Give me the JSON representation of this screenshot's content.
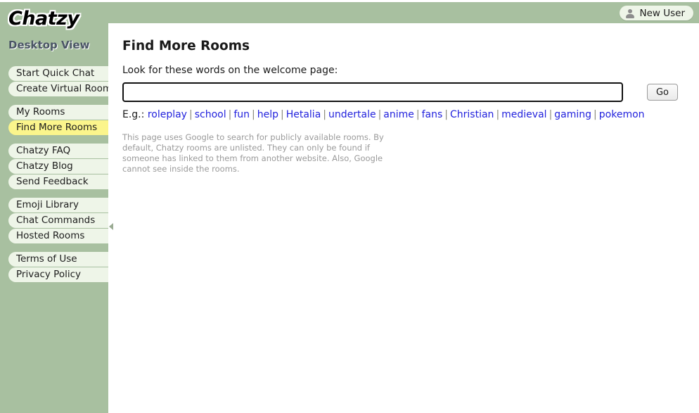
{
  "brand": {
    "logo_text": "Chatzy",
    "view_label": "Desktop View"
  },
  "header": {
    "new_user_label": "New User",
    "new_user_icon": "user-icon"
  },
  "sidebar": {
    "collapse_icon": "chevron-left-icon",
    "groups": [
      {
        "items": [
          {
            "label": "Start Quick Chat",
            "selected": false
          },
          {
            "label": "Create Virtual Room",
            "selected": false
          }
        ]
      },
      {
        "items": [
          {
            "label": "My Rooms",
            "selected": false
          },
          {
            "label": "Find More Rooms",
            "selected": true
          }
        ]
      },
      {
        "items": [
          {
            "label": "Chatzy FAQ",
            "selected": false
          },
          {
            "label": "Chatzy Blog",
            "selected": false
          },
          {
            "label": "Send Feedback",
            "selected": false
          }
        ]
      },
      {
        "items": [
          {
            "label": "Emoji Library",
            "selected": false
          },
          {
            "label": "Chat Commands",
            "selected": false
          },
          {
            "label": "Hosted Rooms",
            "selected": false
          }
        ]
      },
      {
        "items": [
          {
            "label": "Terms of Use",
            "selected": false
          },
          {
            "label": "Privacy Policy",
            "selected": false
          }
        ]
      }
    ]
  },
  "main": {
    "title": "Find More Rooms",
    "prompt": "Look for these words on the welcome page:",
    "search": {
      "value": "",
      "placeholder": "",
      "go_label": "Go"
    },
    "examples": {
      "label": "E.g.:",
      "separator": "|",
      "links": [
        "roleplay",
        "school",
        "fun",
        "help",
        "Hetalia",
        "undertale",
        "anime",
        "fans",
        "Christian",
        "medieval",
        "gaming",
        "pokemon"
      ]
    },
    "note": "This page uses Google to search for publicly available rooms. By default, Chatzy rooms are unlisted. They can only be found if someone has linked to them from another website. Also, Google cannot see inside the rooms."
  },
  "colors": {
    "sidebar_green": "#a8c0a0",
    "nav_item_bg": "#eef5e8",
    "nav_item_selected_bg": "#fbf58c",
    "link_blue": "#2222dd",
    "note_gray": "#9a9a9a"
  }
}
